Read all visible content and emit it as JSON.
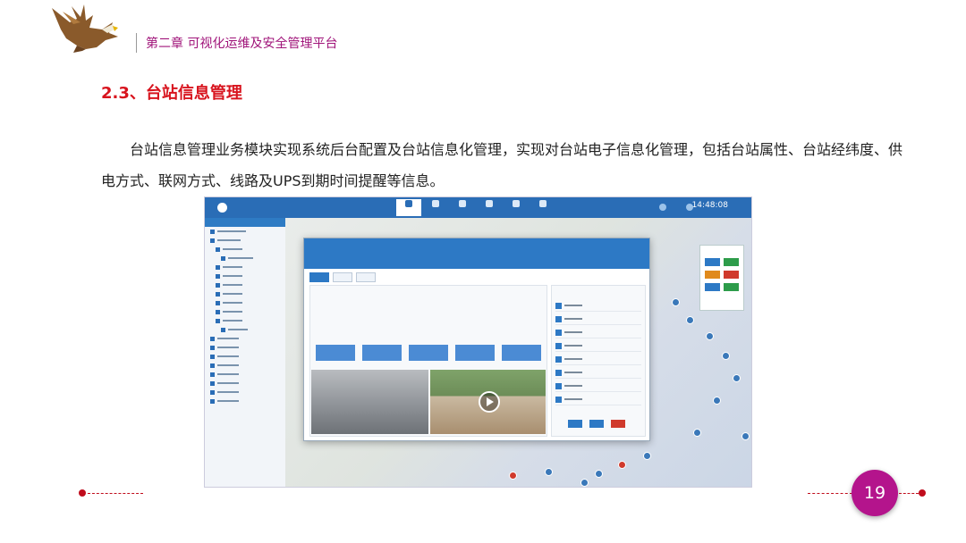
{
  "header": {
    "logo_icon": "eagle-logo",
    "chapter_title": "第二章 可视化运维及安全管理平台"
  },
  "section": {
    "title": "2.3、台站信息管理"
  },
  "body": {
    "paragraph": "台站信息管理业务模块实现系统后台配置及台站信息化管理，实现对台站电子信息化管理，包括台站属性、台站经纬度、供电方式、联网方式、线路及UPS到期时间提醒等信息。"
  },
  "screenshot": {
    "time": "14:48:08"
  },
  "footer": {
    "page_number": "19",
    "accent_color": "#c00c1c",
    "badge_color": "#b4148c"
  }
}
